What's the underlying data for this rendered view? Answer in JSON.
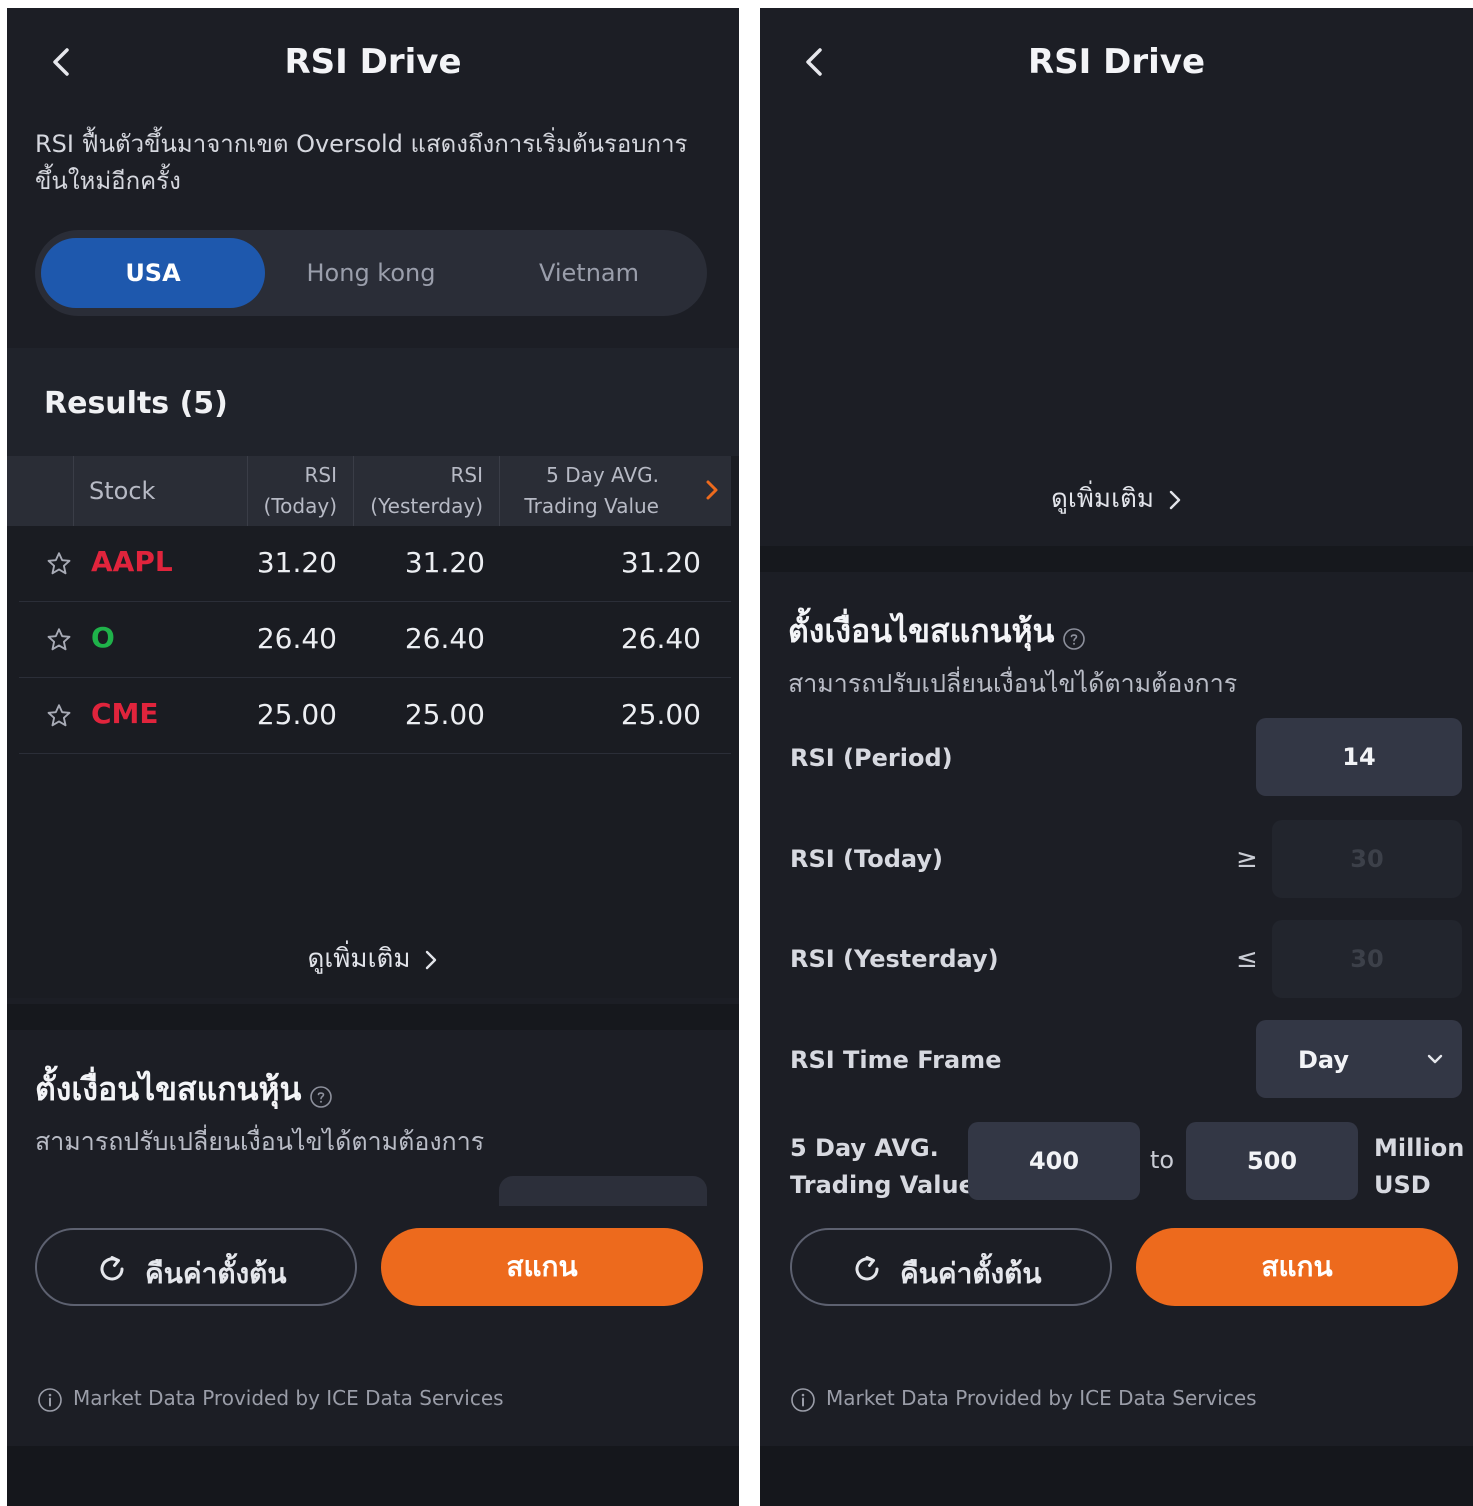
{
  "app": {
    "title": "RSI Drive"
  },
  "description": "RSI ฟื้นตัวขึ้นมาจากเขต Oversold แสดงถึงการเริ่มต้นรอบการขึ้นใหม่อีกครั้ง",
  "markets": [
    {
      "label": "USA",
      "active": true
    },
    {
      "label": "Hong kong",
      "active": false
    },
    {
      "label": "Vietnam",
      "active": false
    }
  ],
  "results": {
    "title": "Results (5)",
    "columns": {
      "stock": "Stock",
      "rsi_today_1": "RSI",
      "rsi_today_2": "(Today)",
      "rsi_yesterday_1": "RSI",
      "rsi_yesterday_2": "(Yesterday)",
      "avg_1": "5 Day AVG.",
      "avg_2": "Trading Value"
    },
    "rows": [
      {
        "symbol": "AAPL",
        "symbol_color": "#e0243c",
        "rsi_today": "31.20",
        "rsi_yesterday": "31.20",
        "avg": "31.20"
      },
      {
        "symbol": "O",
        "symbol_color": "#1fb24a",
        "rsi_today": "26.40",
        "rsi_yesterday": "26.40",
        "avg": "26.40"
      },
      {
        "symbol": "CME",
        "symbol_color": "#e0243c",
        "rsi_today": "25.00",
        "rsi_yesterday": "25.00",
        "avg": "25.00"
      }
    ]
  },
  "see_more": "ดูเพิ่มเติม",
  "conditions": {
    "title": "ตั้งเงื่อนไขสแกนหุ้น",
    "subtitle": "สามารถปรับเปลี่ยนเงื่อนไขได้ตามต้องการ",
    "rsi_period": {
      "label": "RSI (Period)",
      "value": "14"
    },
    "rsi_today": {
      "label": "RSI (Today)",
      "operator": "≥",
      "value": "30"
    },
    "rsi_yesterday": {
      "label": "RSI (Yesterday)",
      "operator": "≤",
      "value": "30"
    },
    "time_frame": {
      "label": "RSI Time Frame",
      "value": "Day"
    },
    "avg_value": {
      "label_1": "5 Day AVG.",
      "label_2": "Trading Value",
      "min": "400",
      "to": "to",
      "max": "500",
      "unit_1": "Million",
      "unit_2": "USD"
    }
  },
  "buttons": {
    "reset": "คืนค่าตั้งต้น",
    "scan": "สแกน"
  },
  "footer": "Market Data Provided by ICE Data Services",
  "colors": {
    "accent_blue": "#1e58ad",
    "accent_orange": "#ed6a1d",
    "background": "#1c1e25"
  },
  "icons": {
    "back": "chevron-left-icon",
    "star": "star-outline-icon",
    "help": "help-circle-icon",
    "reset": "refresh-icon",
    "info": "info-icon"
  }
}
